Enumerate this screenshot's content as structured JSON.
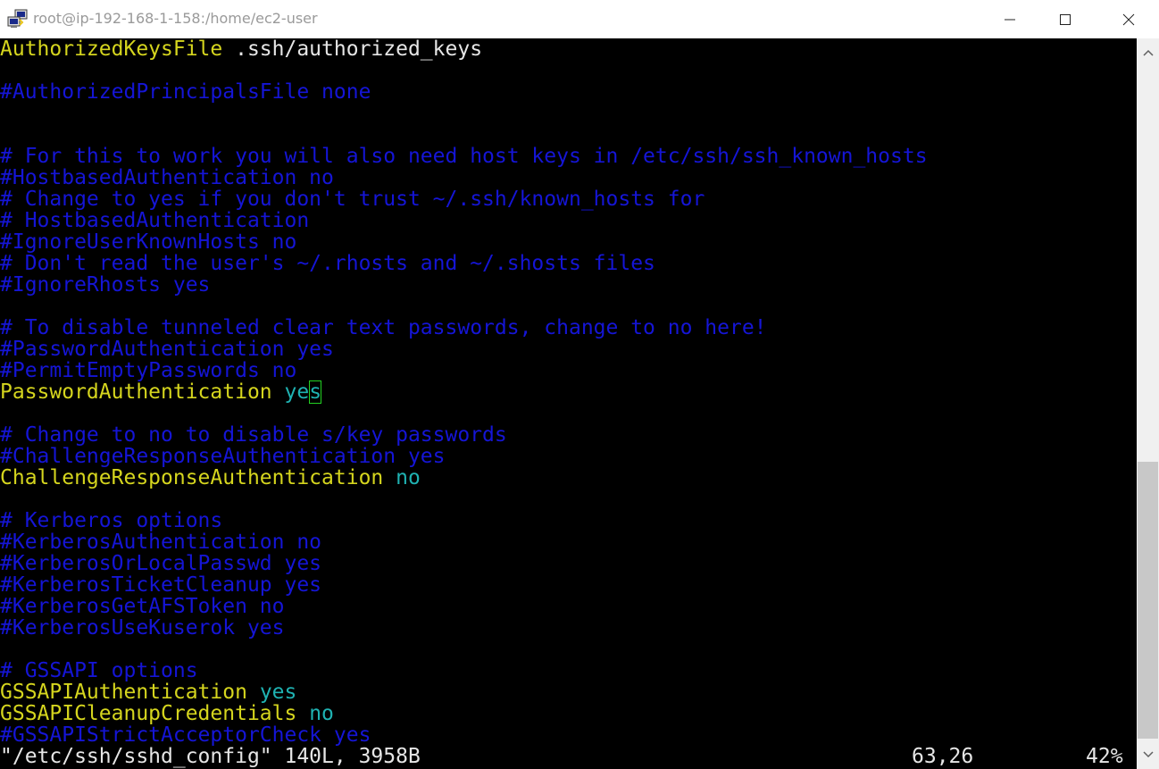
{
  "window": {
    "title": "root@ip-192-168-1-158:/home/ec2-user",
    "icons": {
      "app": "putty-icon",
      "minimize": "minimize-icon",
      "maximize": "maximize-icon",
      "close": "close-icon",
      "scroll_up": "chevron-up-icon",
      "scroll_down": "chevron-down-icon"
    }
  },
  "colors": {
    "background": "#000000",
    "comment": "#1515d6",
    "directive": "#d5d51e",
    "value": "#1fb2b2",
    "text": "#e6e6e6",
    "cursor": "#23d323"
  },
  "editor": {
    "lines": [
      {
        "key": "AuthorizedKeysFile",
        "rest": " .ssh/authorized_keys"
      },
      {
        "comment": "#AuthorizedPrincipalsFile none"
      },
      {},
      {
        "comment": "# For this to work you will also need host keys in /etc/ssh/ssh_known_hosts"
      },
      {
        "comment": "#HostbasedAuthentication no"
      },
      {
        "comment": "# Change to yes if you don't trust ~/.ssh/known_hosts for"
      },
      {
        "comment": "# HostbasedAuthentication"
      },
      {
        "comment": "#IgnoreUserKnownHosts no"
      },
      {
        "comment": "# Don't read the user's ~/.rhosts and ~/.shosts files"
      },
      {
        "comment": "#IgnoreRhosts yes"
      },
      {},
      {
        "comment": "# To disable tunneled clear text passwords, change to no here!"
      },
      {
        "comment": "#PasswordAuthentication yes"
      },
      {
        "comment": "#PermitEmptyPasswords no"
      },
      {
        "key": "PasswordAuthentication",
        "value": "ye",
        "cursor_char": "s"
      },
      {},
      {
        "comment": "# Change to no to disable s/key passwords"
      },
      {
        "comment": "#ChallengeResponseAuthentication yes"
      },
      {
        "key": "ChallengeResponseAuthentication",
        "value": "no"
      },
      {},
      {
        "comment": "# Kerberos options"
      },
      {
        "comment": "#KerberosAuthentication no"
      },
      {
        "comment": "#KerberosOrLocalPasswd yes"
      },
      {
        "comment": "#KerberosTicketCleanup yes"
      },
      {
        "comment": "#KerberosGetAFSToken no"
      },
      {
        "comment": "#KerberosUseKuserok yes"
      },
      {},
      {
        "comment": "# GSSAPI options"
      },
      {
        "key": "GSSAPIAuthentication",
        "value": "yes"
      },
      {
        "key": "GSSAPICleanupCredentials",
        "value": "no"
      },
      {
        "comment": "#GSSAPIStrictAcceptorCheck yes"
      }
    ],
    "status": {
      "file_info": "\"/etc/ssh/sshd_config\" 140L, 3958B",
      "position": "63,26",
      "percent": "42%"
    }
  }
}
